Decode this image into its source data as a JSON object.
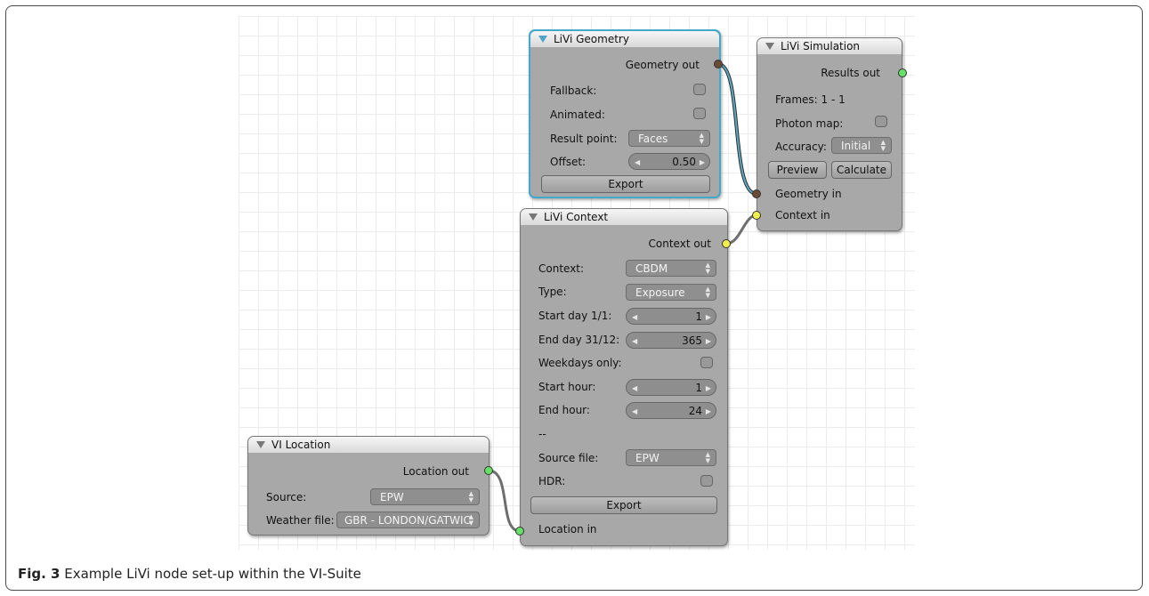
{
  "caption": {
    "fig": "Fig. 3",
    "text": " Example LiVi node set-up within the VI-Suite"
  },
  "nodes": {
    "geometry": {
      "title": "LiVi Geometry",
      "output": "Geometry out",
      "fallback": "Fallback:",
      "animated": "Animated:",
      "result_point_label": "Result point:",
      "result_point_value": "Faces",
      "offset_label": "Offset:",
      "offset_value": "0.50",
      "export": "Export"
    },
    "simulation": {
      "title": "LiVi Simulation",
      "output": "Results out",
      "frames": "Frames: 1 - 1",
      "photon_map": "Photon map:",
      "accuracy_label": "Accuracy:",
      "accuracy_value": "Initial",
      "preview": "Preview",
      "calculate": "Calculate",
      "input_geometry": "Geometry in",
      "input_context": "Context in"
    },
    "context": {
      "title": "LiVi Context",
      "output": "Context out",
      "context_label": "Context:",
      "context_value": "CBDM",
      "type_label": "Type:",
      "type_value": "Exposure",
      "start_day_label": "Start day 1/1:",
      "start_day_value": "1",
      "end_day_label": "End day 31/12:",
      "end_day_value": "365",
      "weekdays_only": "Weekdays only:",
      "start_hour_label": "Start hour:",
      "start_hour_value": "1",
      "end_hour_label": "End hour:",
      "end_hour_value": "24",
      "separator": "--",
      "source_file_label": "Source file:",
      "source_file_value": "EPW",
      "hdr": "HDR:",
      "export": "Export",
      "input_location": "Location in"
    },
    "location": {
      "title": "VI Location",
      "output": "Location out",
      "source_label": "Source:",
      "source_value": "EPW",
      "weather_label": "Weather file:",
      "weather_value": "GBR - LONDON/GATWIC"
    }
  },
  "colors": {
    "node_body": "#a8a8a8",
    "selected_outline": "#45a8c8",
    "socket_geometry": "#6b4a36",
    "socket_results": "#66e066",
    "socket_context": "#f0ee4a",
    "wire_geometry": "#5ba8c0",
    "wire_other": "#6e6e6e"
  }
}
